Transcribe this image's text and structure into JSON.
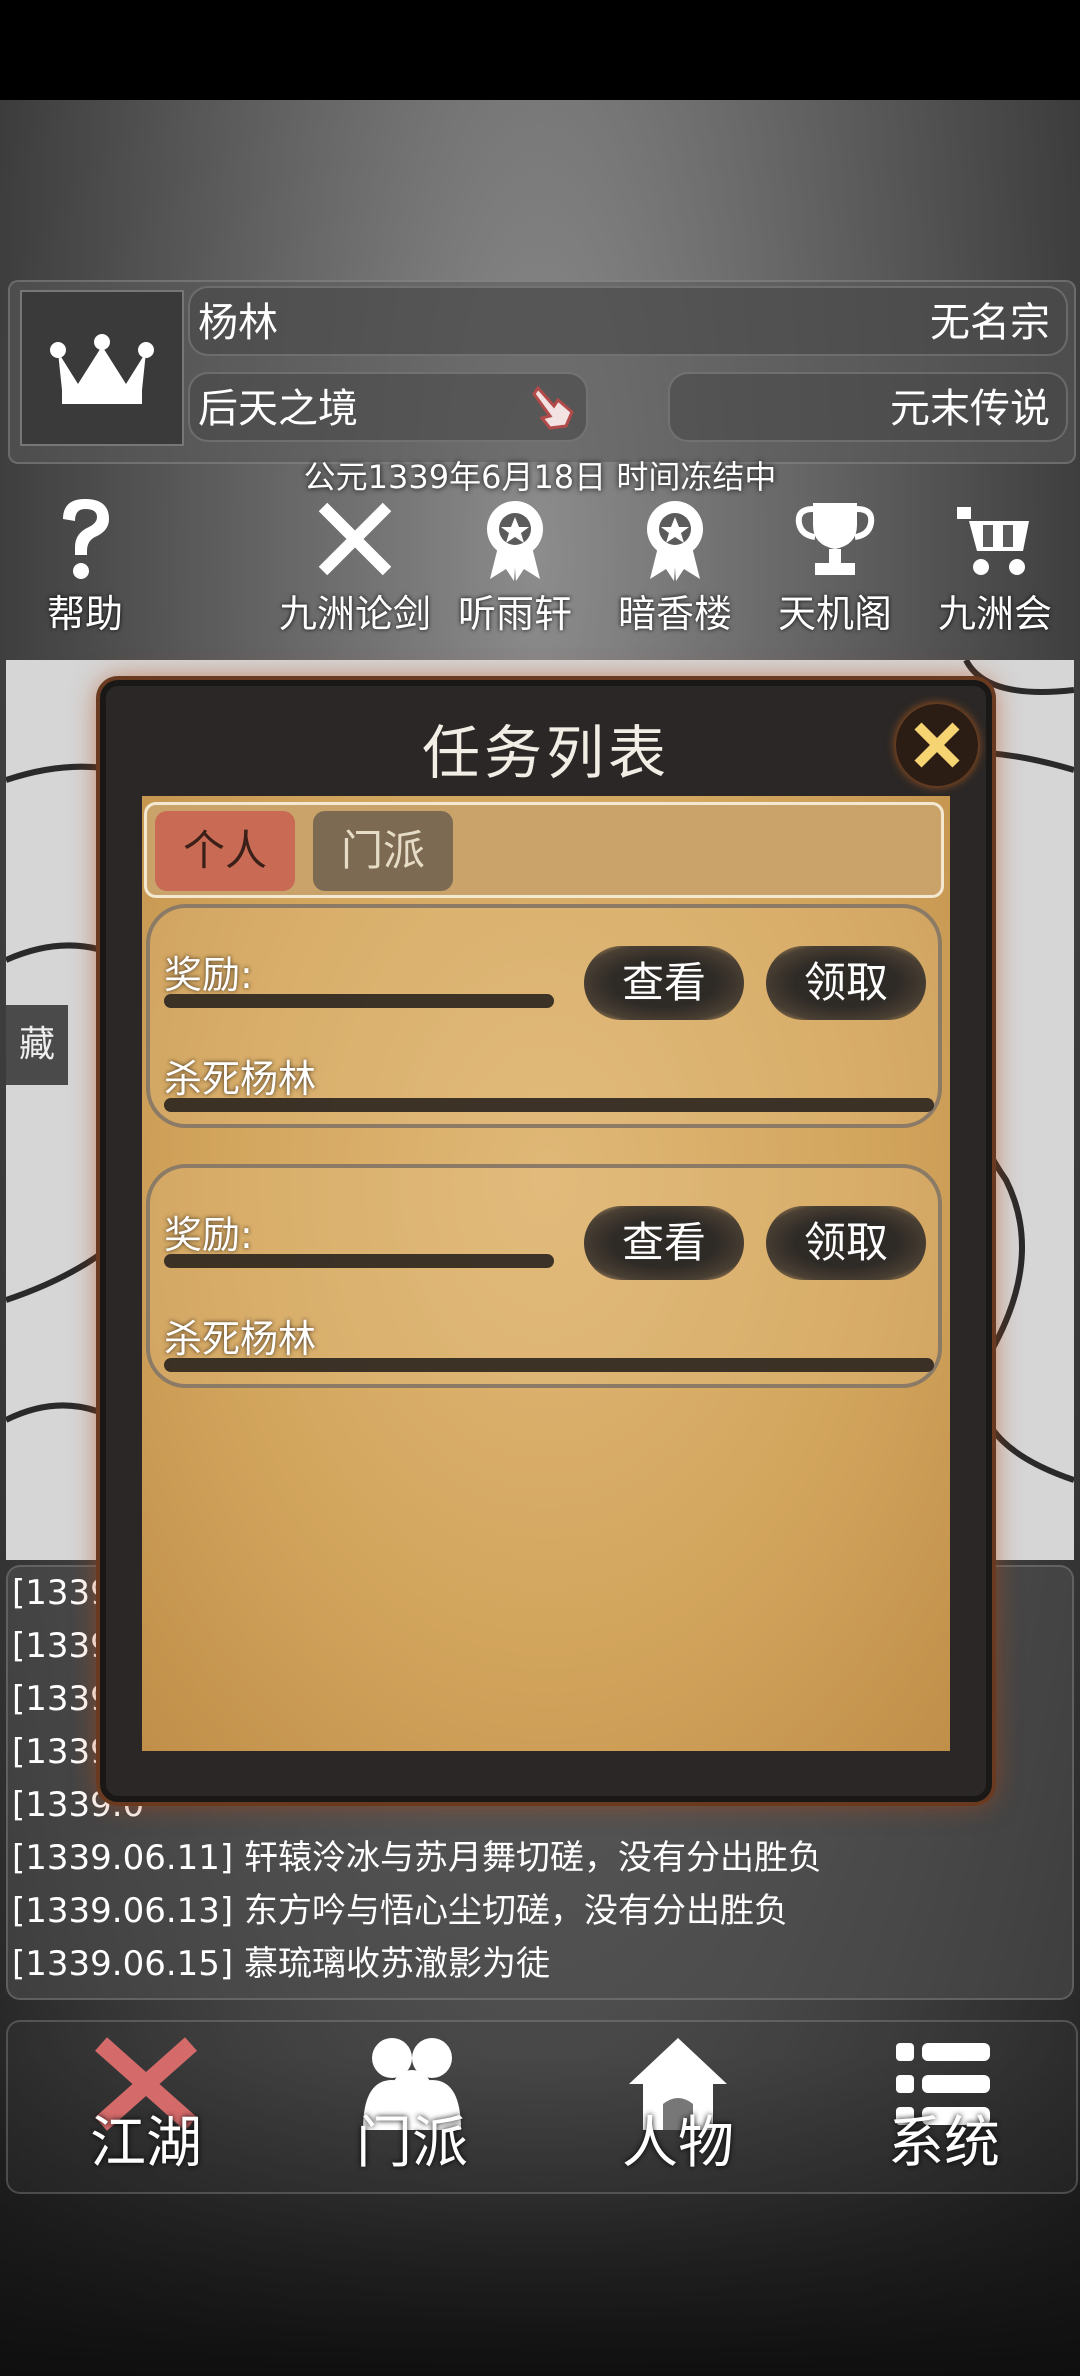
{
  "header": {
    "player_name": "杨林",
    "sect": "无名宗",
    "realm": "后天之境",
    "era": "元末传说",
    "date_status": "公元1339年6月18日 时间冻结中"
  },
  "top_nav": [
    {
      "label": "帮助",
      "icon": "question-icon"
    },
    {
      "label": "九洲论剑",
      "icon": "crossed-swords-icon"
    },
    {
      "label": "听雨轩",
      "icon": "medal-icon"
    },
    {
      "label": "暗香楼",
      "icon": "medal-icon"
    },
    {
      "label": "天机阁",
      "icon": "trophy-icon"
    },
    {
      "label": "九洲会",
      "icon": "cart-icon"
    }
  ],
  "map": {
    "partial_label": "藏"
  },
  "log": {
    "lines": [
      "[1339.",
      "[1339.",
      "[1339",
      "[1339.",
      "[1339.0",
      "[1339.06.11] 轩辕泠冰与苏月舞切磋，没有分出胜负",
      "[1339.06.13] 东方吟与悟心尘切磋，没有分出胜负",
      "[1339.06.15] 慕琉璃收苏澈影为徒"
    ]
  },
  "modal": {
    "title": "任务列表",
    "tabs": [
      {
        "label": "个人",
        "active": true
      },
      {
        "label": "门派",
        "active": false
      }
    ],
    "tasks": [
      {
        "reward_label": "奖励:",
        "goal": "杀死杨林",
        "view_label": "查看",
        "claim_label": "领取"
      },
      {
        "reward_label": "奖励:",
        "goal": "杀死杨林",
        "view_label": "查看",
        "claim_label": "领取"
      }
    ]
  },
  "bottom_nav": [
    {
      "label": "江湖",
      "icon": "crossed-swords-icon"
    },
    {
      "label": "门派",
      "icon": "people-icon"
    },
    {
      "label": "人物",
      "icon": "house-icon"
    },
    {
      "label": "系统",
      "icon": "list-icon"
    }
  ],
  "colors": {
    "tab_active": "#c96a55",
    "tab_inactive": "#7c6b52",
    "parchment": "#d3a65e",
    "modal_frame": "#2a2726",
    "bottom_active_icon": "#d46a6a"
  }
}
